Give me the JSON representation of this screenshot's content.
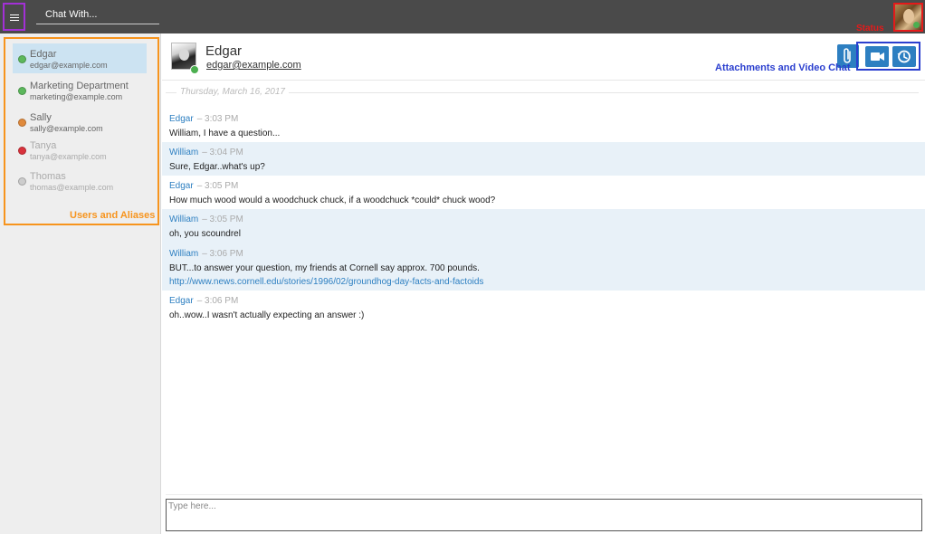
{
  "header": {
    "chat_with_placeholder": "Chat With...",
    "status_label": "Status"
  },
  "sidebar": {
    "users": [
      {
        "name": "Edgar",
        "email": "edgar@example.com",
        "status_color": "#5cb85c",
        "selected": true
      },
      {
        "name": "Marketing Department",
        "email": "marketing@example.com",
        "status_color": "#5cb85c"
      },
      {
        "name": "Sally",
        "email": "sally@example.com",
        "status_color": "#e08a3c"
      },
      {
        "name": "Tanya",
        "email": "tanya@example.com",
        "status_color": "#d9323c"
      },
      {
        "name": "Thomas",
        "email": "thomas@example.com",
        "status_color": "#cccccc"
      }
    ],
    "annotation": "Users and Aliases"
  },
  "conversation": {
    "contact_name": "Edgar",
    "contact_email": "edgar@example.com",
    "annotation": "Attachments and Video Chat",
    "date": "Thursday, March 16, 2017",
    "messages": [
      {
        "sender": "Edgar",
        "time": "– 3:03 PM",
        "text": "William, I have a question..."
      },
      {
        "sender": "William",
        "time": "– 3:04 PM",
        "text": "Sure, Edgar..what's up?"
      },
      {
        "sender": "Edgar",
        "time": "– 3:05 PM",
        "text": "How much wood would a woodchuck chuck, if a woodchuck *could* chuck wood?"
      },
      {
        "sender": "William",
        "time": "– 3:05 PM",
        "text": "oh, you scoundrel"
      },
      {
        "sender": "William",
        "time": "– 3:06 PM",
        "text": "BUT...to answer your question, my friends at Cornell say approx. 700 pounds.",
        "link": "http://www.news.cornell.edu/stories/1996/02/groundhog-day-facts-and-factoids"
      },
      {
        "sender": "Edgar",
        "time": "– 3:06 PM",
        "text": "oh..wow..I wasn't actually expecting an answer :)"
      }
    ],
    "input_placeholder": "Type here..."
  },
  "colors": {
    "accent": "#2d7fc1",
    "topbar": "#4a4a4a",
    "status_online": "#4caf50",
    "menu_outline": "#a330d6",
    "status_outline": "#e51a1a",
    "users_outline": "#f7941d",
    "video_outline": "#2b3fcf"
  }
}
